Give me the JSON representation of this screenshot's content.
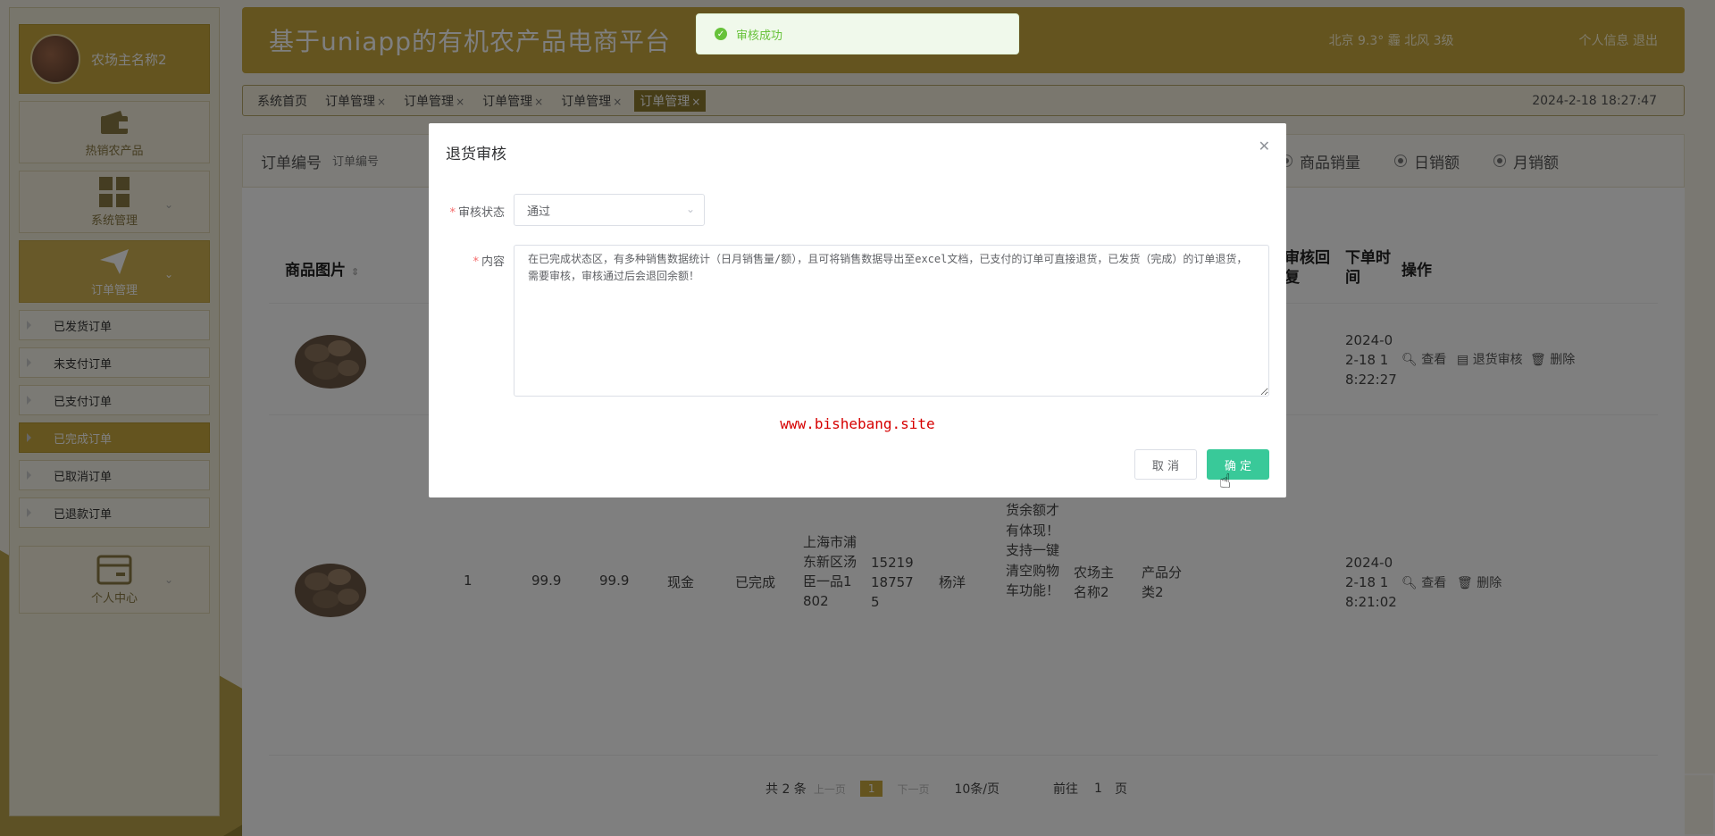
{
  "header": {
    "title": "基于uniapp的有机农产品电商平台",
    "weather": "北京 9.3° 霾 北风 3级",
    "links": "个人信息 退出"
  },
  "sidebar": {
    "user_name": "农场主名称2",
    "menus": [
      {
        "label": "热销农产品",
        "icon": "wallet-icon"
      },
      {
        "label": "系统管理",
        "icon": "grid-icon"
      },
      {
        "label": "订单管理",
        "icon": "send-icon"
      }
    ],
    "sub_items": [
      "已发货订单",
      "未支付订单",
      "已支付订单",
      "已完成订单",
      "已取消订单",
      "已退款订单"
    ],
    "personal": {
      "label": "个人中心",
      "icon": "card-icon"
    }
  },
  "tabs": {
    "items": [
      "系统首页",
      "订单管理",
      "订单管理",
      "订单管理",
      "订单管理",
      "订单管理"
    ],
    "close": "×",
    "clock": "2024-2-18 18:27:47"
  },
  "search": {
    "label": "订单编号",
    "placeholder": "订单编号",
    "radios": [
      "商品销量",
      "日销额",
      "月销额"
    ]
  },
  "table": {
    "headers": {
      "image": "商品图片",
      "review": "审核回复",
      "time": "下单时间",
      "ops": "操作"
    },
    "row1": {
      "time": "2024-02-18 18:22:27",
      "ops": [
        "查看",
        "退货审核",
        "删除"
      ]
    },
    "row2": {
      "qty": "1",
      "price": "99.9",
      "total": "99.9",
      "pay": "现金",
      "status": "已完成",
      "address": "上海市浦东新区汤臣一品1802",
      "phone": "15219187575",
      "name": "杨洋",
      "note_tail": "额，支持多种订单状态功能转换，退货余额才有体现！支持一键清空购物车功能！",
      "shop": "农场主名称2",
      "category": "产品分类2",
      "time": "2024-02-18 18:21:02",
      "ops": [
        "查看",
        "删除"
      ]
    }
  },
  "pager": {
    "total": "共 2 条",
    "prev": "上一页",
    "page": "1",
    "next": "下一页",
    "size": "10条/页",
    "goto": "前往",
    "goto_value": "1",
    "goto_unit": "页"
  },
  "toast": {
    "text": "审核成功"
  },
  "modal": {
    "title": "退货审核",
    "status_label": "审核状态",
    "status_value": "通过",
    "content_label": "内容",
    "content": "在已完成状态区，有多种销售数据统计（日月销售量/额），且可将销售数据导出至excel文档，已支付的订单可直接退货，已发货（完成）的订单退货，需要审核，审核通过后会退回余额！",
    "watermark": "www.bishebang.site",
    "cancel": "取 消",
    "confirm": "确 定"
  }
}
